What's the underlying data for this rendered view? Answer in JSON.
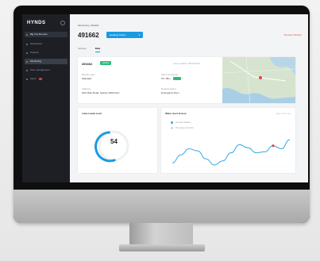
{
  "sidebar": {
    "logo": "HYNDS",
    "items": [
      {
        "label": "Big City Remote",
        "state": "active"
      },
      {
        "label": "Dashboard",
        "state": "normal"
      },
      {
        "label": "Projects",
        "state": "normal"
      },
      {
        "label": "Monitoring",
        "state": "selected"
      },
      {
        "label": "User management",
        "state": "normal"
      },
      {
        "label": "Alerts",
        "state": "badge"
      }
    ]
  },
  "header": {
    "breadcrumb": "Monitoring  /  491662",
    "title": "491662",
    "pill_label": "Heading button",
    "action_link": "Remove Monitor"
  },
  "tabs": [
    "Settings",
    "Data"
  ],
  "summary": {
    "id": "491662",
    "status": "Active",
    "meta": "Last updated: 08/02/2019",
    "fields": [
      {
        "label": "Monitor type",
        "value": "Standard"
      },
      {
        "label": "Alarm threshold",
        "value": "70 / 95m"
      },
      {
        "label": "Address",
        "value": "10th Main Road, Sydney 2000 (AU)"
      },
      {
        "label": "Nearest Asset",
        "value": "Emergency Dam"
      }
    ]
  },
  "level_card": {
    "title": "Latest water level",
    "value": "54",
    "fraction": 0.54
  },
  "history_card": {
    "title": "Water level history",
    "meta": "Past 12 hours",
    "legend": [
      "Current status",
      "Previous records"
    ]
  },
  "chart_data": {
    "type": "line",
    "title": "Water level history",
    "series": [
      {
        "name": "Current status",
        "values": [
          12,
          20,
          26,
          24,
          16,
          10,
          14,
          22,
          30,
          27,
          22,
          23,
          29,
          26,
          35
        ]
      }
    ],
    "highlight_index": 12,
    "colors": {
      "line": "#3aa7e4",
      "highlight": "#e0434a"
    }
  },
  "colors": {
    "accent": "#1a9be0",
    "success": "#2ebd7a",
    "danger": "#d44444",
    "sidebar": "#1d1f24"
  }
}
